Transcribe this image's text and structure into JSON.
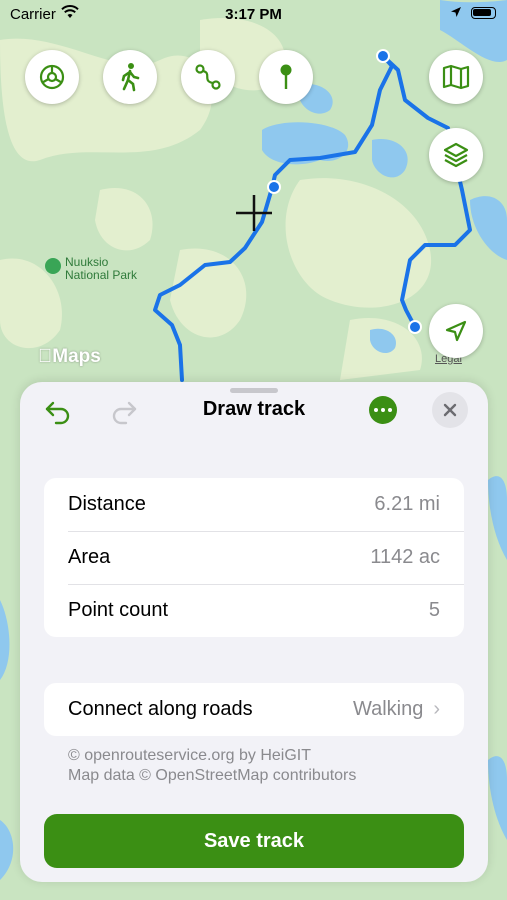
{
  "status_bar": {
    "carrier": "Carrier",
    "time": "3:17 PM"
  },
  "map": {
    "park_label_line1": "Nuuksio",
    "park_label_line2": "National Park",
    "attribution_logo": "Maps",
    "legal_link": "Legal"
  },
  "toolbar": {
    "icons": [
      "settings-gear-icon",
      "walking-person-icon",
      "route-icon",
      "map-pin-icon",
      "map-icon",
      "layers-icon",
      "location-arrow-icon"
    ]
  },
  "sheet": {
    "title": "Draw track",
    "stats": [
      {
        "label": "Distance",
        "value": "6.21 mi"
      },
      {
        "label": "Area",
        "value": "1142 ac"
      },
      {
        "label": "Point count",
        "value": "5"
      }
    ],
    "routing": {
      "label": "Connect along roads",
      "value": "Walking"
    },
    "credits_line1": "© openrouteservice.org by HeiGIT",
    "credits_line2": "Map data © OpenStreetMap contributors",
    "save_label": "Save track"
  },
  "colors": {
    "accent": "#3b8f14",
    "route": "#1a73e8",
    "water": "#8fc8ee",
    "forest": "#bfe0b5"
  }
}
